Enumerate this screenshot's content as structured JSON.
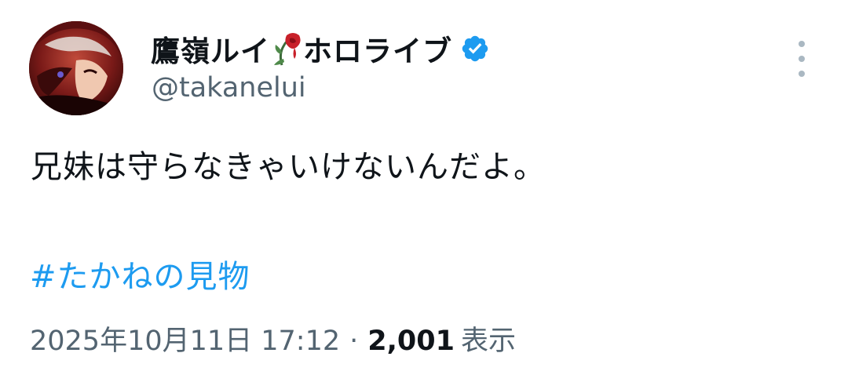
{
  "author": {
    "display_name_part1": "鷹嶺ルイ",
    "display_name_part2": "ホロライブ",
    "handle": "@takanelui",
    "rose_icon": "wilted-rose-icon",
    "verified_icon": "verified-badge-icon"
  },
  "tweet": {
    "text": "兄妹は守らなきゃいけないんだよ。",
    "hashtag": "#たかねの見物"
  },
  "meta": {
    "timestamp": "2025年10月11日 17:12",
    "separator": "·",
    "views_count": "2,001",
    "views_label": "表示"
  },
  "colors": {
    "text_primary": "#0f1419",
    "text_secondary": "#536471",
    "link": "#1d9bf0",
    "verified": "#1d9bf0",
    "more_dots": "#aab8c2"
  }
}
